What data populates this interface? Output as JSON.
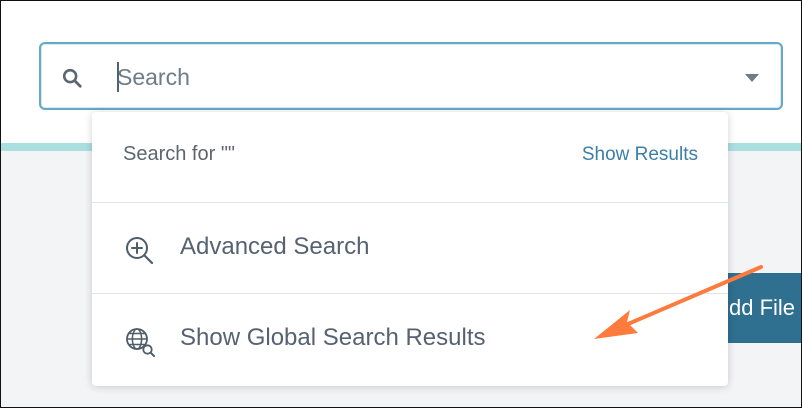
{
  "search": {
    "placeholder": "Search",
    "search_icon": "search-icon",
    "dropdown_icon": "chevron-down-icon"
  },
  "dropdown": {
    "search_for_label": "Search for \"\"",
    "show_results_label": "Show Results",
    "items": [
      {
        "label": "Advanced Search",
        "icon": "zoom-in-icon"
      },
      {
        "label": "Show Global Search Results",
        "icon": "globe-search-icon"
      }
    ]
  },
  "background": {
    "partial_button_label": "dd File"
  },
  "colors": {
    "border": "#67a8c8",
    "link": "#3c7fa8",
    "accent_strip": "#a9dfdf",
    "button": "#2f6f8f",
    "arrow": "#ff7a3d"
  }
}
